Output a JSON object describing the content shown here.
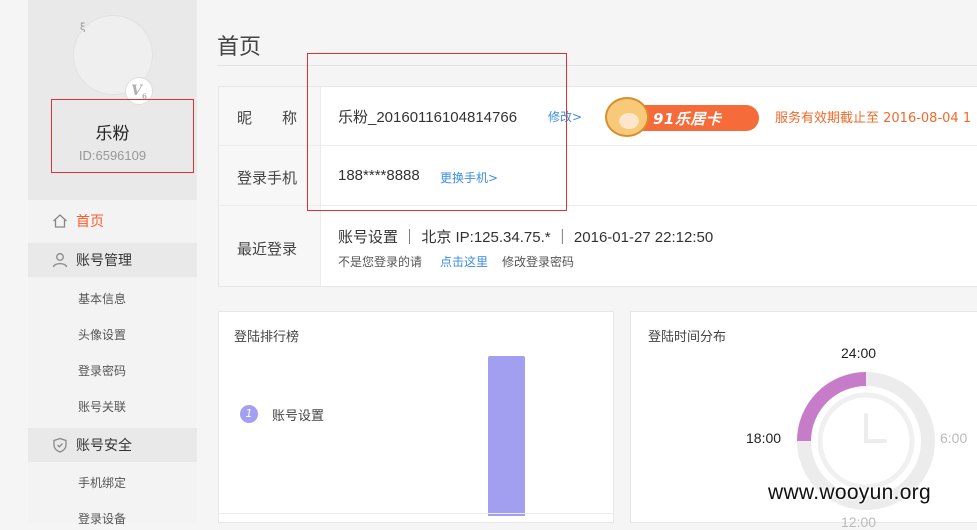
{
  "sidebar": {
    "avatar_glyph": "ξ",
    "vip_label": "V",
    "vip_level": "6",
    "username": "乐粉",
    "user_id": "ID:6596109",
    "nav": {
      "home": "首页",
      "account_mgmt": "账号管理",
      "basic_info": "基本信息",
      "avatar_settings": "头像设置",
      "login_password": "登录密码",
      "account_link": "账号关联",
      "account_security": "账号安全",
      "phone_binding": "手机绑定",
      "login_devices": "登录设备"
    }
  },
  "main": {
    "page_title": "首页",
    "info": {
      "nickname_label": "昵　　称",
      "nickname_value": "乐粉_20160116104814766",
      "edit_link": "修改>",
      "card_text": "91乐居卡",
      "expiry_text": "服务有效期截止至 2016-08-04 1",
      "phone_label": "登录手机",
      "phone_value": "188****8888",
      "change_phone_link": "更换手机>",
      "recent_label": "最近登录",
      "recent_value": "账号设置 ｜ 北京 IP:125.34.75.* ｜ 2016-01-27 22:12:50",
      "not_you_text": "不是您登录的请",
      "click_here_link": "点击这里",
      "change_pwd_text": "修改登录密码"
    },
    "ranking": {
      "title": "登陆排行榜",
      "rank_number": "1",
      "item_label": "账号设置"
    },
    "time_dist": {
      "title": "登陆时间分布",
      "label_top": "24:00",
      "label_left": "18:00",
      "label_right": "6:00",
      "label_bottom": "12:00"
    }
  },
  "watermark": "www.wooyun.org",
  "colors": {
    "accent_orange": "#ff5a2c",
    "link_blue": "#3a8ee6",
    "bar_purple": "#a29ff1",
    "arc_pink": "#c77cc9",
    "annotation_red": "#dd3333"
  }
}
